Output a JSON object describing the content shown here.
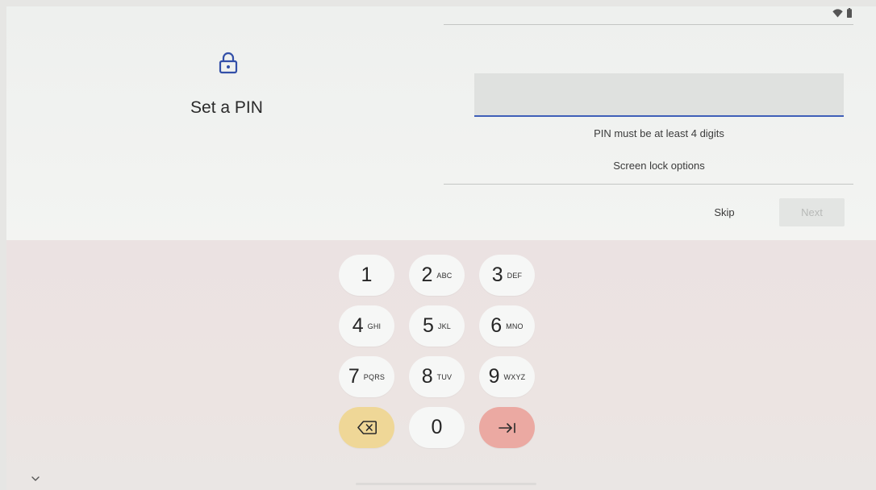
{
  "status_bar": {
    "icons": [
      "wifi-icon",
      "battery-icon"
    ]
  },
  "setup": {
    "lock_icon": "lock-icon",
    "title": "Set a PIN",
    "pin_input_value": "",
    "hint": "PIN must be at least 4 digits",
    "screen_lock_options": "Screen lock options",
    "skip_label": "Skip",
    "next_label": "Next"
  },
  "keypad": {
    "keys": [
      {
        "digit": "1",
        "letters": ""
      },
      {
        "digit": "2",
        "letters": "ABC"
      },
      {
        "digit": "3",
        "letters": "DEF"
      },
      {
        "digit": "4",
        "letters": "GHI"
      },
      {
        "digit": "5",
        "letters": "JKL"
      },
      {
        "digit": "6",
        "letters": "MNO"
      },
      {
        "digit": "7",
        "letters": "PQRS"
      },
      {
        "digit": "8",
        "letters": "TUV"
      },
      {
        "digit": "9",
        "letters": "WXYZ"
      },
      {
        "digit": "0",
        "letters": ""
      }
    ],
    "delete_icon": "backspace-icon",
    "enter_icon": "tab-arrow-icon"
  },
  "colors": {
    "accent": "#3f5fb8",
    "delete_key": "#efd797",
    "enter_key": "#eba9a2"
  }
}
